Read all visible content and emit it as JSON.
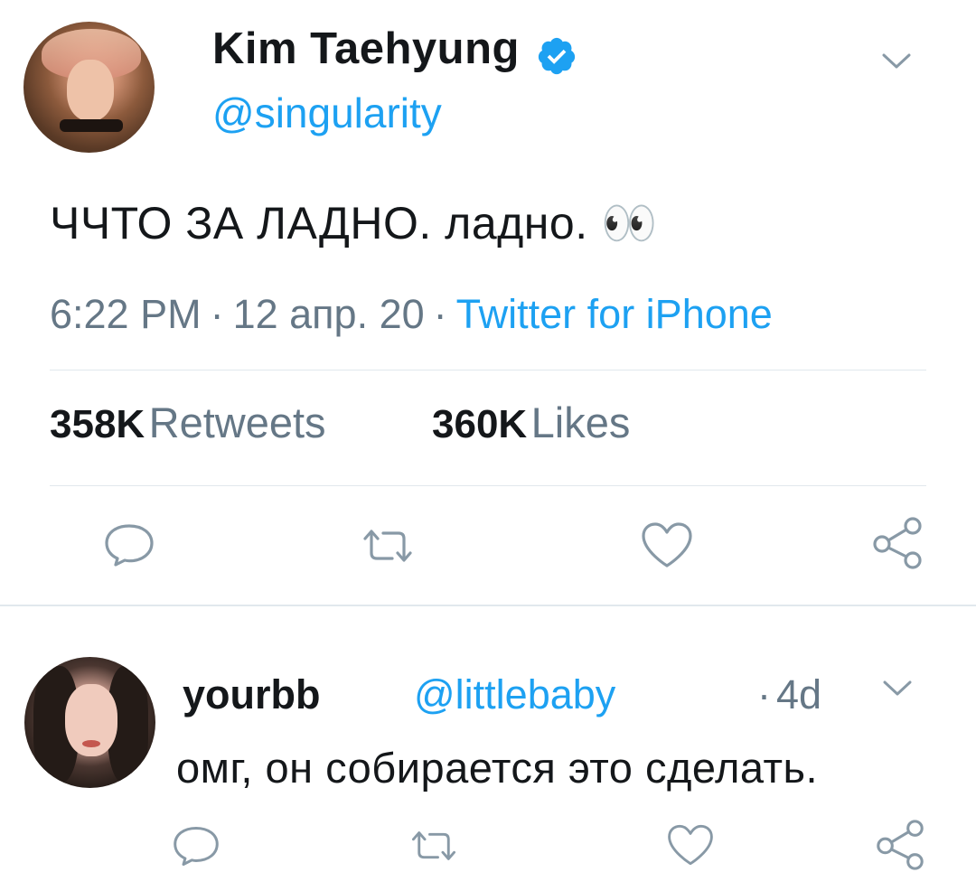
{
  "main_tweet": {
    "author_name": "Kim Taehyung",
    "author_handle": "@singularity",
    "text": "ЧЧТО ЗА ЛАДНО. ладно. 👀",
    "time": "6:22 PM",
    "date": "12 апр. 20",
    "source": "Twitter for iPhone",
    "retweets_count": "358K",
    "retweets_label": "Retweets",
    "likes_count": "360K",
    "likes_label": "Likes",
    "separator": "·"
  },
  "reply": {
    "author_name": "yourbb",
    "author_handle": "@littlebaby",
    "time": "4d",
    "separator": "·",
    "text": "омг, он собирается это сделать."
  },
  "icons": [
    "verified-icon",
    "chevron-down-icon",
    "reply-icon",
    "retweet-icon",
    "like-icon",
    "share-icon"
  ],
  "colors": {
    "link_blue": "#1da1f2",
    "secondary_text": "#657786",
    "primary_text": "#14171a",
    "divider": "#e1e8ed"
  }
}
